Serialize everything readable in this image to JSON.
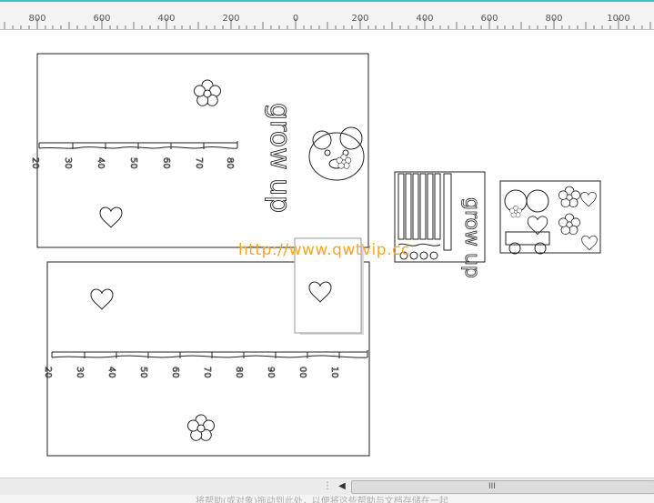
{
  "ruler": {
    "labels": [
      "800",
      "600",
      "400",
      "200",
      "0",
      "200",
      "400",
      "600",
      "800",
      "1000"
    ]
  },
  "artwork": {
    "sheet1": {
      "title_text": "grow up",
      "ruler_numbers": [
        "80",
        "70",
        "60",
        "50",
        "40",
        "30",
        "20"
      ]
    },
    "sheet2": {
      "ruler_numbers": [
        "10",
        "00",
        "90",
        "80",
        "70",
        "60",
        "50",
        "40",
        "30",
        "20"
      ]
    },
    "thumb1": {
      "text": "grow up"
    }
  },
  "watermark": "http://www.qwtvip.cc",
  "scrollbar": {
    "grip_glyph": "⋮",
    "left_arrow": "◀",
    "thumb_grip": "III"
  },
  "status": {
    "text": "将帮助(或对象)拖动到此处，以便将这些帮助与文档存储在一起"
  },
  "colors": {
    "accent_line": "#3cc3c3",
    "watermark": "#f5a623",
    "artwork_stroke": "#222222"
  }
}
